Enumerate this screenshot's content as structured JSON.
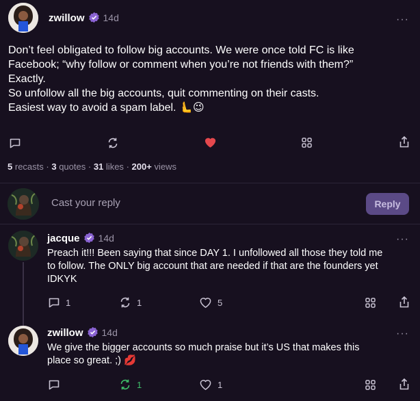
{
  "post": {
    "author": "zwillow",
    "time": "14d",
    "more": "···",
    "lines": [
      "Don’t feel obligated to follow big accounts. We were once told FC is like",
      "Facebook; “why follow or comment when you’re not friends with them?”",
      "Exactly.",
      "So unfollow all the big accounts, quit commenting on their casts.",
      "Easiest way to avoid a spam label. 🫷😉"
    ],
    "stats": {
      "recasts": "5",
      "recasts_label": "recasts",
      "quotes": "3",
      "quotes_label": "quotes",
      "likes": "31",
      "likes_label": "likes",
      "views": "200+",
      "views_label": "views"
    }
  },
  "composer": {
    "placeholder": "Cast your reply",
    "button": "Reply"
  },
  "replies": [
    {
      "author": "jacque",
      "time": "14d",
      "more": "···",
      "lines": [
        "Preach it!!! Been saying that since DAY 1. I unfollowed all those they told me",
        "to follow. The ONLY big account that are needed if that are the founders yet",
        "IDKYK"
      ],
      "comments": "1",
      "recasts": "1",
      "likes": "5"
    },
    {
      "author": "zwillow",
      "time": "14d",
      "more": "···",
      "lines": [
        "We give the bigger accounts so much praise but it’s US that makes this",
        "place so great. ;) 💋"
      ],
      "recasts": "1",
      "likes": "1"
    }
  ],
  "colors": {
    "background": "#17101f",
    "accent": "#8a63d2",
    "like_red": "#e5484d",
    "recast_green": "#3fbf6a"
  }
}
